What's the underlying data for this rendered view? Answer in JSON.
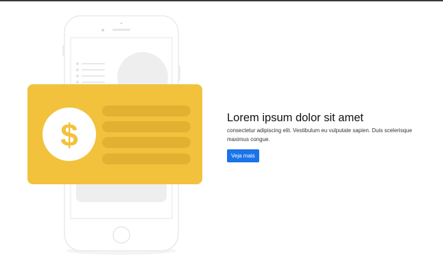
{
  "hero": {
    "title": "Lorem ipsum dolor sit amet",
    "body": "consectetur adipiscing elit. Vestibulum eu vulputate sapien. Duis scelerisque maximus congue.",
    "button_label": "Veja mais",
    "button_color": "#1a73e8"
  },
  "illustration": {
    "card_color": "#f2c23c",
    "card_line_color": "#e2b132",
    "coin_symbol": "$",
    "icons": [
      "smartphone-icon",
      "payment-card-icon",
      "dollar-coin-icon"
    ]
  }
}
